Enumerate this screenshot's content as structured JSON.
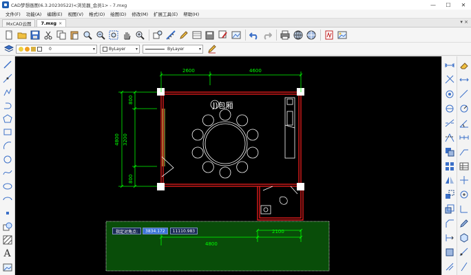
{
  "window": {
    "title": "CAD梦想画图(6.3.20230522)<浏览器_会员1> - 7.mxg",
    "minimize": "—",
    "maximize": "☐",
    "close": "✕"
  },
  "menu": {
    "items": [
      "文件(F)",
      "功能(A)",
      "编辑(E)",
      "视图(V)",
      "格式(O)",
      "绘图(D)",
      "修改(M)",
      "扩展工具(E)",
      "帮助(H)"
    ]
  },
  "tabs": [
    {
      "label": "MxCAD云图",
      "active": false
    },
    {
      "label": "7.mxg",
      "active": true
    }
  ],
  "tabbar_right": "▾ ×",
  "toolbar": {
    "icons": [
      "new-file-icon",
      "open-folder-icon",
      "save-icon",
      "cut-icon",
      "copy-icon",
      "paste-icon",
      "zoom-window-icon",
      "zoom-out-icon",
      "zoom-extents-icon",
      "pan-hand-icon",
      "zoom-realtime-icon",
      "match-properties-icon",
      "measure-icon",
      "pen-icon",
      "layer-manager-icon",
      "save-as-icon",
      "brush-icon",
      "image-icon",
      "undo-icon",
      "redo-icon",
      "print-icon",
      "web-globe-icon",
      "network-icon",
      "pdf-icon",
      "picture-icon"
    ]
  },
  "properties": {
    "layer_value": "0",
    "color_value": "ByLayer",
    "linetype_value": "ByLayer"
  },
  "drawing": {
    "room_label": "J)包厢",
    "dim_top_left": "2600",
    "dim_top_right": "4600",
    "dim_left_outer": "4800",
    "dim_left_inner": "3200",
    "dim_left_top": "800",
    "dim_left_bottom": "800",
    "dim_bottom_left": "4800",
    "dim_bottom_right": "2100"
  },
  "prompt": {
    "label": "指定对角点:",
    "x_value": "3834.172",
    "y_value": "11110.983"
  },
  "colors": {
    "canvas_bg": "#000000",
    "wall": "#ff2020",
    "dimension": "#00ff00",
    "selection": "#0a5a0a",
    "furniture": "#ffffff"
  }
}
